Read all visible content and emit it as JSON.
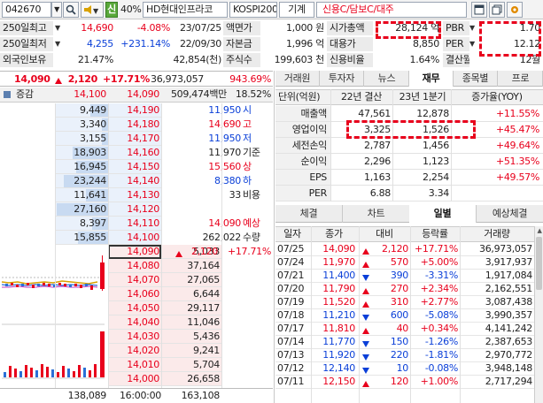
{
  "toolbar": {
    "code": "042670",
    "badge_shin": "신",
    "margin_rate": "40%",
    "stock_name": "HD현대인프라코",
    "market": "KOSPI200",
    "sector": "기계",
    "credit_info": "신용C/담보C/대주"
  },
  "summary": {
    "rows": [
      {
        "label": "250일최고",
        "price": "14,690",
        "rate": "-4.08%",
        "date": "23/07/25"
      },
      {
        "label": "250일최저",
        "price": "4,255",
        "rate": "+231.14%",
        "date": "22/09/30"
      },
      {
        "label": "외국인보유",
        "price": "21.47%",
        "rate": "",
        "date": "42,854(천)"
      }
    ],
    "mid": [
      {
        "label": "액면가",
        "value": "1,000 원"
      },
      {
        "label": "자본금",
        "value": "1,996 억"
      },
      {
        "label": "주식수",
        "value": "199,603 천"
      }
    ],
    "right": [
      {
        "label": "시가총액",
        "value": "28,124 억"
      },
      {
        "label": "대용가",
        "value": "8,850"
      },
      {
        "label": "신용비율",
        "value": "1.64%"
      }
    ],
    "far": [
      {
        "label": "PBR",
        "value": "1.70"
      },
      {
        "label": "PER",
        "value": "12.12"
      },
      {
        "label": "결산월",
        "value": "12월"
      }
    ]
  },
  "quote": {
    "price": "14,090",
    "change": "2,120",
    "rate": "+17.71%",
    "volume": "36,973,057",
    "vol_rate": "943.69%"
  },
  "orderbook": {
    "header": {
      "label": "증감",
      "prev_close": "14,100",
      "price": "14,090",
      "amount": "509,474백만",
      "turnover": "18.52%"
    },
    "ask": [
      {
        "qty": "9,449",
        "price": "14,190"
      },
      {
        "qty": "3,340",
        "price": "14,180"
      },
      {
        "qty": "3,155",
        "price": "14,170"
      },
      {
        "qty": "18,903",
        "price": "14,160"
      },
      {
        "qty": "16,945",
        "price": "14,150"
      },
      {
        "qty": "23,244",
        "price": "14,140"
      },
      {
        "qty": "11,641",
        "price": "14,130"
      },
      {
        "qty": "27,160",
        "price": "14,120"
      },
      {
        "qty": "8,397",
        "price": "14,110"
      },
      {
        "qty": "15,855",
        "price": "14,100"
      }
    ],
    "bid": [
      {
        "price": "14,090",
        "qty": "5,033"
      },
      {
        "price": "14,080",
        "qty": "37,164"
      },
      {
        "price": "14,070",
        "qty": "27,065"
      },
      {
        "price": "14,060",
        "qty": "6,644"
      },
      {
        "price": "14,050",
        "qty": "29,117"
      },
      {
        "price": "14,040",
        "qty": "11,046"
      },
      {
        "price": "14,030",
        "qty": "5,436"
      },
      {
        "price": "14,020",
        "qty": "9,241"
      },
      {
        "price": "14,010",
        "qty": "5,704"
      },
      {
        "price": "14,000",
        "qty": "26,658"
      }
    ],
    "info": [
      {
        "value": "11,950",
        "label": "시",
        "color": "blue"
      },
      {
        "value": "14,690",
        "label": "고",
        "color": "red"
      },
      {
        "value": "11,950",
        "label": "저",
        "color": "blue"
      },
      {
        "value": "11,970",
        "label": "기준",
        "color": "blk"
      },
      {
        "value": "15,560",
        "label": "상",
        "color": "red"
      },
      {
        "value": "8,380",
        "label": "하",
        "color": "blue"
      },
      {
        "value": "33",
        "label": "비용",
        "color": "blk"
      },
      {
        "value": "",
        "label": "",
        "color": "blk"
      },
      {
        "value": "14,090",
        "label": "예상",
        "color": "red"
      },
      {
        "value": "262,022",
        "label": "수량",
        "color": "blk"
      },
      {
        "value": "2,120",
        "label": "+17.71%",
        "color": "red"
      }
    ],
    "footer": {
      "ask_total": "138,089",
      "time": "16:00:00",
      "bid_total": "163,108",
      "after_label": "시간외",
      "after_value": "22,126"
    }
  },
  "finance": {
    "tabs": [
      "거래원",
      "투자자",
      "뉴스",
      "재무",
      "종목별",
      "프로"
    ],
    "active_tab": "재무",
    "header": [
      "단위(억원)",
      "22년 결산",
      "23년 1분기",
      "증가율(YOY)"
    ],
    "rows": [
      {
        "label": "매출액",
        "a": "47,561",
        "b": "12,878",
        "c": "+11.55%",
        "color": "red"
      },
      {
        "label": "영업이익",
        "a": "3,325",
        "b": "1,526",
        "c": "+45.47%",
        "color": "red"
      },
      {
        "label": "세전손익",
        "a": "2,787",
        "b": "1,456",
        "c": "+49.64%",
        "color": "red"
      },
      {
        "label": "순이익",
        "a": "2,296",
        "b": "1,123",
        "c": "+51.35%",
        "color": "red"
      },
      {
        "label": "EPS",
        "a": "1,163",
        "b": "2,254",
        "c": "+49.57%",
        "color": "red"
      },
      {
        "label": "PER",
        "a": "6.88",
        "b": "3.34",
        "c": "",
        "color": "blk"
      }
    ]
  },
  "daily": {
    "tabs": [
      "체결",
      "차트",
      "일별",
      "예상체결"
    ],
    "active_tab": "일별",
    "header": [
      "일자",
      "종가",
      "대비",
      "등락률",
      "거래량"
    ],
    "rows": [
      {
        "date": "07/25",
        "close": "14,090",
        "dir": "up",
        "diff": "2,120",
        "rate": "+17.71%",
        "vol": "36,973,057",
        "color": "red"
      },
      {
        "date": "07/24",
        "close": "11,970",
        "dir": "up",
        "diff": "570",
        "rate": "+5.00%",
        "vol": "3,917,937",
        "color": "red"
      },
      {
        "date": "07/21",
        "close": "11,400",
        "dir": "down",
        "diff": "390",
        "rate": "-3.31%",
        "vol": "1,917,084",
        "color": "blue"
      },
      {
        "date": "07/20",
        "close": "11,790",
        "dir": "up",
        "diff": "270",
        "rate": "+2.34%",
        "vol": "2,162,551",
        "color": "red"
      },
      {
        "date": "07/19",
        "close": "11,520",
        "dir": "up",
        "diff": "310",
        "rate": "+2.77%",
        "vol": "3,087,438",
        "color": "red"
      },
      {
        "date": "07/18",
        "close": "11,210",
        "dir": "down",
        "diff": "600",
        "rate": "-5.08%",
        "vol": "3,990,357",
        "color": "blue"
      },
      {
        "date": "07/17",
        "close": "11,810",
        "dir": "up",
        "diff": "40",
        "rate": "+0.34%",
        "vol": "4,141,242",
        "color": "red"
      },
      {
        "date": "07/14",
        "close": "11,770",
        "dir": "down",
        "diff": "150",
        "rate": "-1.26%",
        "vol": "2,387,653",
        "color": "blue"
      },
      {
        "date": "07/13",
        "close": "11,920",
        "dir": "down",
        "diff": "220",
        "rate": "-1.81%",
        "vol": "2,970,772",
        "color": "blue"
      },
      {
        "date": "07/12",
        "close": "12,140",
        "dir": "down",
        "diff": "10",
        "rate": "-0.08%",
        "vol": "3,948,148",
        "color": "blue"
      },
      {
        "date": "07/11",
        "close": "12,150",
        "dir": "up",
        "diff": "120",
        "rate": "+1.00%",
        "vol": "2,717,294",
        "color": "red"
      }
    ]
  }
}
